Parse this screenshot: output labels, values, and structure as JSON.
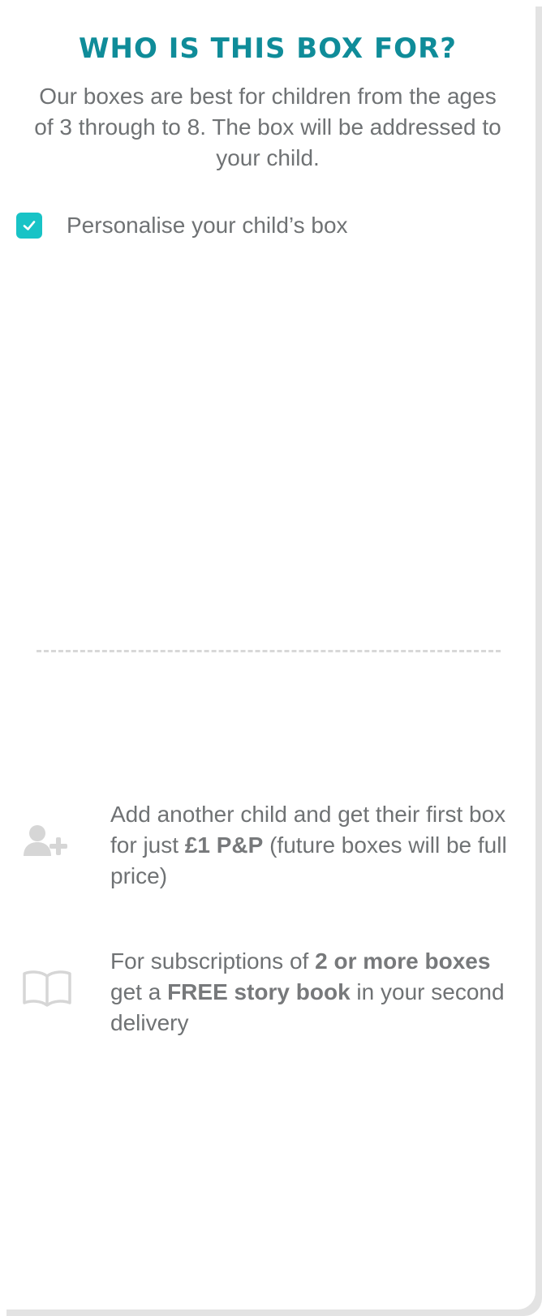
{
  "colors": {
    "title": "#0f8c99",
    "body_text": "#6f7274",
    "checkbox": "#18c3c6",
    "icon": "#d6d6d6",
    "divider": "#d8d8d8"
  },
  "section": {
    "title": "WHO IS THIS BOX FOR?",
    "intro": "Our boxes are best for children from the ages of 3 through to 8. The box will be addressed to your child."
  },
  "personalise": {
    "checked": true,
    "label": "Personalise your child’s box"
  },
  "offers": [
    {
      "icon": "add-user-icon",
      "parts": [
        "Add another child and get their first box for just ",
        "£1 P&P",
        " (future boxes will be full price)"
      ]
    },
    {
      "icon": "book-icon",
      "parts": [
        "For subscriptions of ",
        "2 or more boxes",
        " get a ",
        "FREE story book",
        " in your second delivery"
      ]
    }
  ]
}
